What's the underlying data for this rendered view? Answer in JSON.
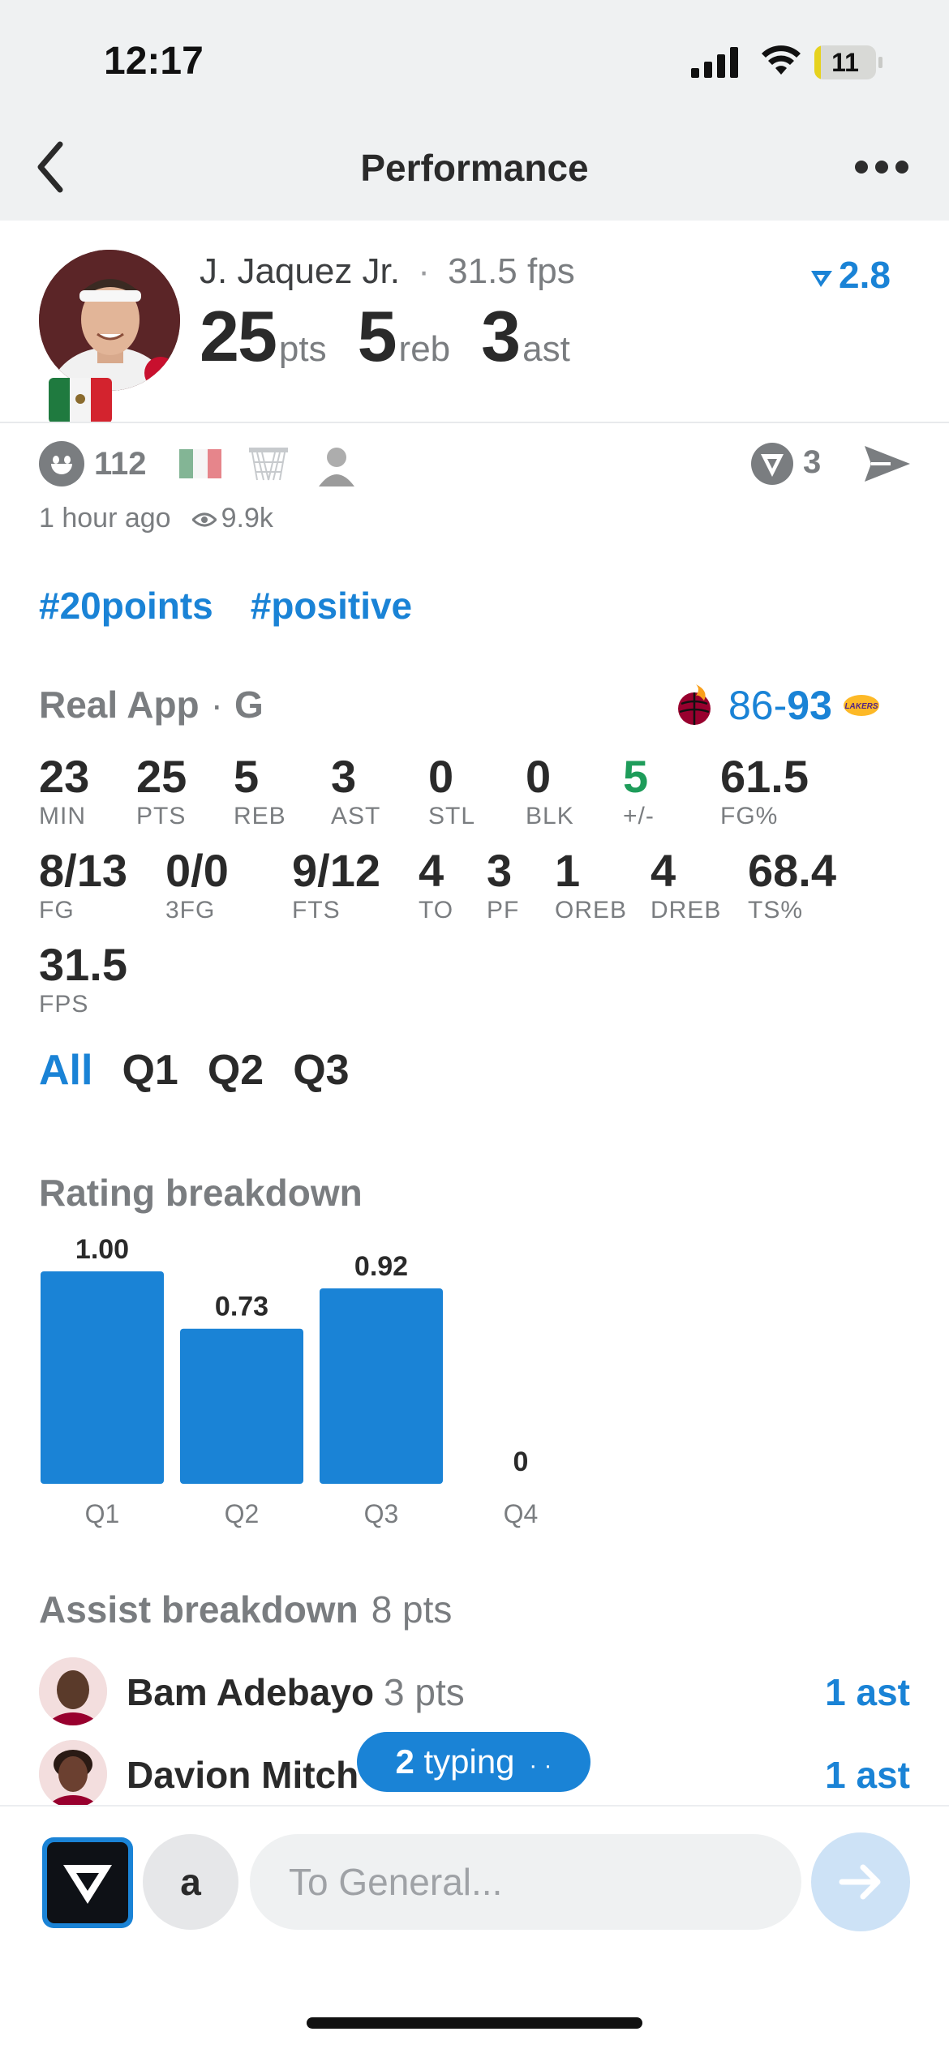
{
  "status_bar": {
    "time": "12:17",
    "battery": "11",
    "battery_level": 0.11
  },
  "nav": {
    "title": "Performance"
  },
  "post": {
    "player_name": "J. Jaquez Jr.",
    "fps": "31.5 fps",
    "rating_change": "2.8",
    "headline_stats": [
      {
        "value": "25",
        "unit": "pts"
      },
      {
        "value": "5",
        "unit": "reb"
      },
      {
        "value": "3",
        "unit": "ast"
      }
    ],
    "reaction_count": "112",
    "comment_count": "3",
    "time_ago": "1 hour ago",
    "views": "9.9k",
    "hashtags": [
      "#20points",
      "#positive"
    ]
  },
  "game": {
    "league": "Real App",
    "position": "G",
    "home_score": "86",
    "away_score": "93",
    "box": [
      {
        "value": "23",
        "label": "MIN"
      },
      {
        "value": "25",
        "label": "PTS"
      },
      {
        "value": "5",
        "label": "REB"
      },
      {
        "value": "3",
        "label": "AST"
      },
      {
        "value": "0",
        "label": "STL"
      },
      {
        "value": "0",
        "label": "BLK"
      },
      {
        "value": "5",
        "label": "+/-"
      },
      {
        "value": "61.5",
        "label": "FG%"
      },
      {
        "value": "8/13",
        "label": "FG"
      },
      {
        "value": "0/0",
        "label": "3FG"
      },
      {
        "value": "9/12",
        "label": "FTS"
      },
      {
        "value": "4",
        "label": "TO"
      },
      {
        "value": "3",
        "label": "PF"
      },
      {
        "value": "1",
        "label": "OREB"
      },
      {
        "value": "4",
        "label": "DREB"
      },
      {
        "value": "68.4",
        "label": "TS%"
      },
      {
        "value": "31.5",
        "label": "FPS"
      }
    ],
    "tabs": [
      "All",
      "Q1",
      "Q2",
      "Q3"
    ]
  },
  "rating": {
    "title": "Rating breakdown",
    "chart_data": {
      "type": "bar",
      "categories": [
        "Q1",
        "Q2",
        "Q3",
        "Q4"
      ],
      "values": [
        1.0,
        0.73,
        0.92,
        0
      ],
      "value_labels": [
        "1.00",
        "0.73",
        "0.92",
        "0"
      ],
      "color": "#1a83d6",
      "ylim": [
        0,
        1
      ]
    }
  },
  "assists": {
    "title": "Assist breakdown",
    "total": "8 pts",
    "rows": [
      {
        "name": "Bam Adebayo",
        "pts": "3 pts",
        "ast": "1 ast"
      },
      {
        "name": "Davion Mitch",
        "pts": "",
        "ast": "1 ast"
      }
    ]
  },
  "typing": {
    "count": "2",
    "label": "typing"
  },
  "composer": {
    "user_initial": "a",
    "placeholder": "To General..."
  },
  "colors": {
    "accent": "#1a83d6",
    "positive": "#1e9c5a",
    "text": "#2a2a2a",
    "muted": "#7a7d80"
  }
}
